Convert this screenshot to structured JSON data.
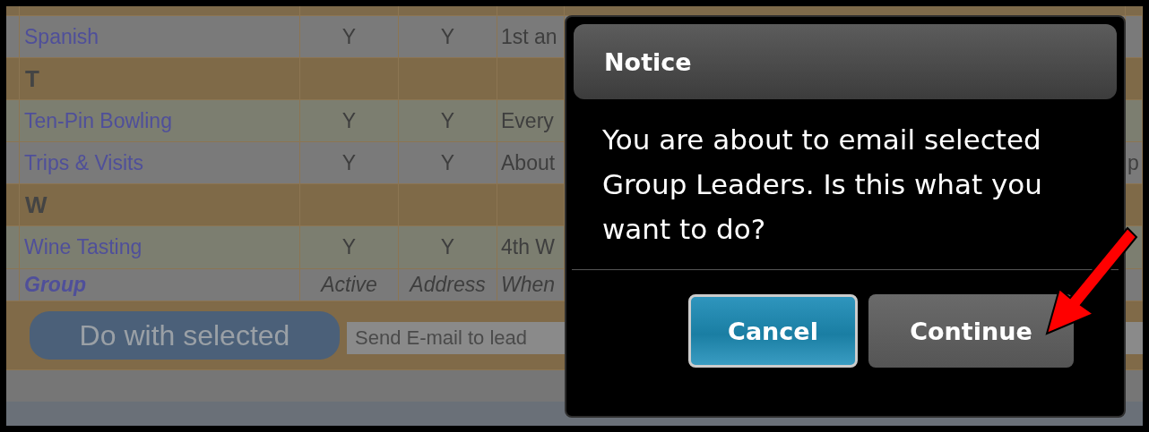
{
  "table": {
    "rows": [
      {
        "kind": "group",
        "name": "Spanish",
        "active": "Y",
        "address": "Y",
        "when": "1st an"
      },
      {
        "kind": "letter",
        "letter": "T"
      },
      {
        "kind": "group",
        "name": "Ten-Pin Bowling",
        "active": "Y",
        "address": "Y",
        "when": "Every"
      },
      {
        "kind": "group",
        "name": "Trips & Visits",
        "active": "Y",
        "address": "Y",
        "when": "About",
        "column_5": "p"
      },
      {
        "kind": "letter",
        "letter": "W"
      },
      {
        "kind": "group",
        "name": "Wine Tasting",
        "active": "Y",
        "address": "Y",
        "when": "4th W"
      },
      {
        "kind": "header",
        "name": "Group",
        "active": "Active",
        "address": "Address",
        "when": "When"
      }
    ]
  },
  "action_bar": {
    "button": "Do with selected",
    "field_value": "Send E-mail to lead"
  },
  "dialog": {
    "title": "Notice",
    "message": "You are about to email selected Group Leaders. Is this what you want to do?",
    "buttons": [
      {
        "label": "Cancel",
        "kind": "primary"
      },
      {
        "label": "Continue",
        "kind": "secondary"
      }
    ]
  }
}
